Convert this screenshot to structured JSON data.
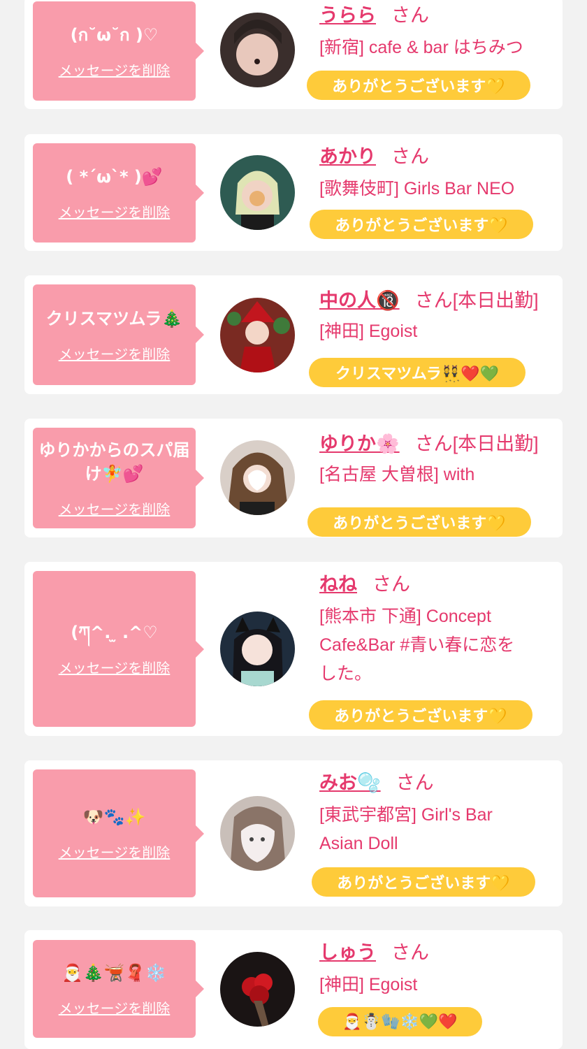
{
  "delete_label": "メッセージを削除",
  "honorific": "さん",
  "colors": {
    "bubble": "#f99cab",
    "accent": "#e5396d",
    "reply_pill": "#fecb3a",
    "background": "#f2f2f2"
  },
  "cards": [
    {
      "message": "(ก˘ω˘ก )♡",
      "name": "うらら",
      "status": "",
      "shop_lines": [
        "[新宿] cafe & bar はちみつ"
      ],
      "reply": "ありがとうございます💛"
    },
    {
      "message": "( *´ω`* )💕",
      "name": "あかり",
      "status": "",
      "shop_lines": [
        "[歌舞伎町] Girls Bar NEO"
      ],
      "reply": "ありがとうございます💛"
    },
    {
      "message": "クリスマツムラ🎄",
      "name": "中の人🔞",
      "status": "[本日出勤]",
      "shop_lines": [
        "[神田] Egoist"
      ],
      "reply": "クリスマツムラ👯❤️💚"
    },
    {
      "message": "ゆりかからのスパ届け🧚💕",
      "name": "ゆりか🌸",
      "status": "[本日出勤]",
      "shop_lines": [
        "[名古屋 大曽根] with"
      ],
      "reply": "ありがとうございます💛"
    },
    {
      "message": "(ཀ^. ̫ .^♡",
      "name": "ねね",
      "status": "",
      "shop_lines": [
        "[熊本市 下通] Concept",
        "Cafe&Bar #青い春に恋を",
        "した。"
      ],
      "reply": "ありがとうございます💛"
    },
    {
      "message": "🐶🐾✨",
      "name": "みお🫧",
      "status": "",
      "shop_lines": [
        "[東武宇都宮] Girl's Bar",
        "Asian Doll"
      ],
      "reply": "ありがとうございます💛"
    },
    {
      "message": "🎅🎄🫕🧣❄️",
      "name": "しゅう",
      "status": "",
      "shop_lines": [
        "[神田] Egoist"
      ],
      "reply": "🎅☃️🧤❄️💚❤️"
    }
  ]
}
